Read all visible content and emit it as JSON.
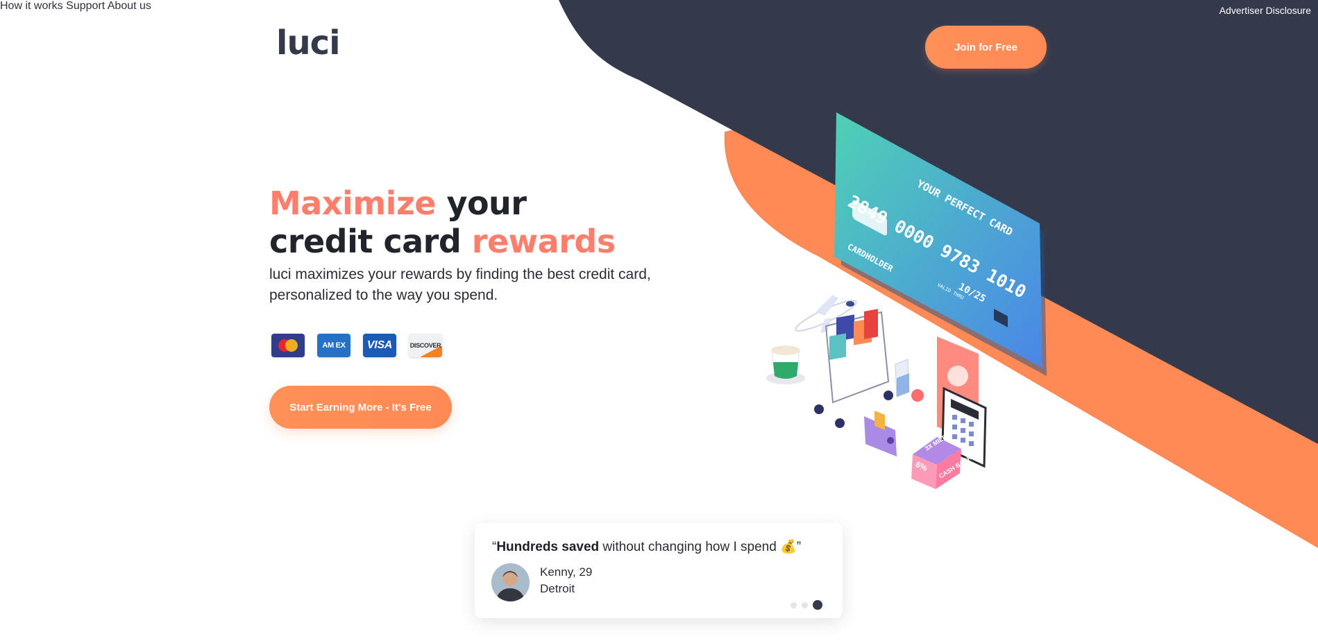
{
  "header": {
    "advertiser_disclosure": "Advertiser Disclosure",
    "logo": "luci",
    "nav": [
      {
        "label": "How it works"
      },
      {
        "label": "Support"
      },
      {
        "label": "About us"
      }
    ],
    "join_button": "Join for Free"
  },
  "hero": {
    "headline_part1_highlight": "Maximize",
    "headline_part2": " your",
    "headline_part3": "credit card ",
    "headline_part4_highlight": "rewards",
    "subtitle": "luci maximizes your rewards by finding the best credit card, personalized to the way you spend.",
    "card_logos": [
      {
        "name": "mastercard",
        "label": ""
      },
      {
        "name": "amex",
        "label": "AM EX"
      },
      {
        "name": "visa",
        "label": "VISA"
      },
      {
        "name": "discover",
        "label": "DISCOVER"
      }
    ],
    "cta_button": "Start Earning More - It's Free"
  },
  "illustration": {
    "card_number": "2849 0000 9783 1010",
    "card_title": "YOUR PERFECT CARD",
    "cardholder": "CARDHOLDER",
    "valid_thru_label": "VALID THRU",
    "valid_thru": "10/25",
    "box_miles": "3X MILES",
    "box_percent": "6%",
    "box_cashback": "CASH BACK"
  },
  "testimonial": {
    "quote_open": "“",
    "quote_bold": "Hundreds saved",
    "quote_rest": " without changing how I spend ",
    "quote_emoji": "💰",
    "quote_close": "”",
    "author_name": "Kenny, 29",
    "author_city": "Detroit",
    "carousel_total": 3,
    "carousel_active": 3
  },
  "colors": {
    "dark_navy": "#343a4c",
    "orange": "#ff8a55",
    "highlight": "#ff7e6b",
    "card_gradient_start": "#4fd1b5",
    "card_gradient_end": "#4a86e8"
  }
}
